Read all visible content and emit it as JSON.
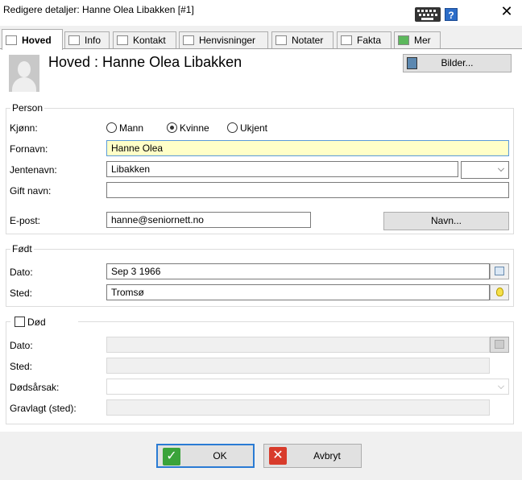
{
  "window": {
    "title": "Redigere detaljer: Hanne Olea Libakken [#1]",
    "help_label": "?",
    "close_label": "✕"
  },
  "tabs": [
    {
      "label": "Hoved",
      "icon": "document-icon",
      "active": true
    },
    {
      "label": "Info",
      "icon": "info-list-icon"
    },
    {
      "label": "Kontakt",
      "icon": "house-icon"
    },
    {
      "label": "Henvisninger",
      "icon": "references-icon"
    },
    {
      "label": "Notater",
      "icon": "note-icon"
    },
    {
      "label": "Fakta",
      "icon": "facts-icon"
    },
    {
      "label": "Mer",
      "icon": "plus-icon"
    }
  ],
  "header": {
    "title": "Hoved : Hanne Olea Libakken",
    "pictures_button": "Bilder..."
  },
  "person": {
    "legend": "Person",
    "gender_label": "Kjønn:",
    "gender_options": [
      "Mann",
      "Kvinne",
      "Ukjent"
    ],
    "gender_selected": "Kvinne",
    "firstname_label": "Fornavn:",
    "firstname_value": "Hanne Olea",
    "maiden_label": "Jentenavn:",
    "maiden_value": "Libakken",
    "married_label": "Gift navn:",
    "married_value": "",
    "email_label": "E-post:",
    "email_value": "hanne@seniornett.no",
    "names_button": "Navn..."
  },
  "born": {
    "legend": "Født",
    "date_label": "Dato:",
    "date_value": "Sep 3 1966",
    "place_label": "Sted:",
    "place_value": "Tromsø"
  },
  "death": {
    "legend": "Død",
    "checked": false,
    "date_label": "Dato:",
    "place_label": "Sted:",
    "cause_label": "Dødsårsak:",
    "burial_label": "Gravlagt (sted):"
  },
  "footer": {
    "ok_label": "OK",
    "cancel_label": "Avbryt"
  },
  "colors": {
    "highlight_field": "#ffffc8",
    "ok_green": "#3aa33a",
    "cancel_red": "#d83b2b",
    "default_button_border": "#2a7bd4"
  }
}
